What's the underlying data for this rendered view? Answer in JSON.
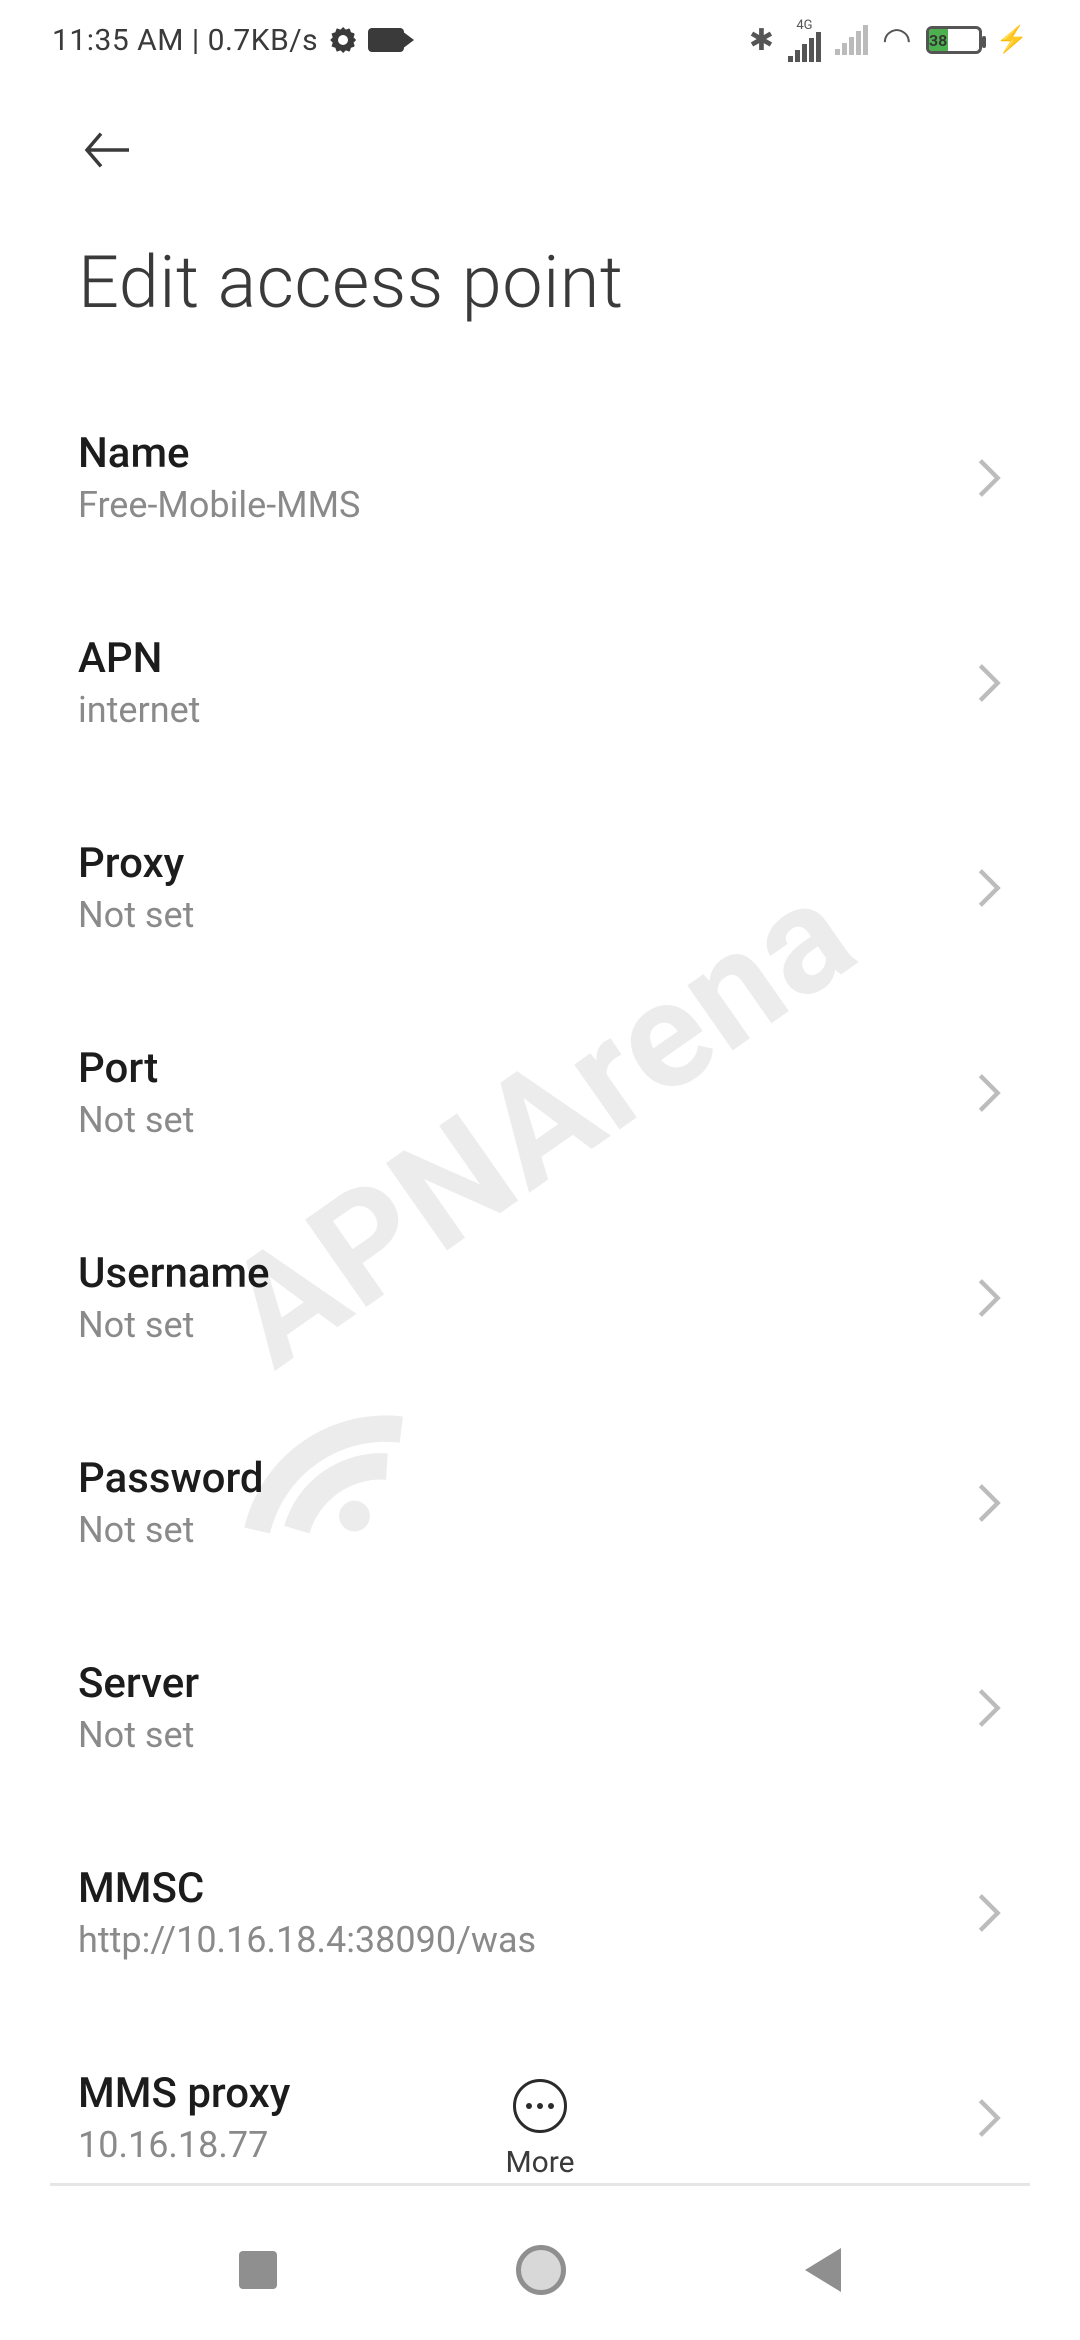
{
  "status": {
    "time": "11:35 AM",
    "net_speed": "0.7KB/s",
    "signal_label": "4G",
    "battery_pct": "38"
  },
  "page": {
    "title": "Edit access point"
  },
  "settings": [
    {
      "key": "name",
      "label": "Name",
      "value": "Free-Mobile-MMS"
    },
    {
      "key": "apn",
      "label": "APN",
      "value": "internet"
    },
    {
      "key": "proxy",
      "label": "Proxy",
      "value": "Not set"
    },
    {
      "key": "port",
      "label": "Port",
      "value": "Not set"
    },
    {
      "key": "username",
      "label": "Username",
      "value": "Not set"
    },
    {
      "key": "password",
      "label": "Password",
      "value": "Not set"
    },
    {
      "key": "server",
      "label": "Server",
      "value": "Not set"
    },
    {
      "key": "mmsc",
      "label": "MMSC",
      "value": "http://10.16.18.4:38090/was"
    },
    {
      "key": "mms-proxy",
      "label": "MMS proxy",
      "value": "10.16.18.77"
    }
  ],
  "toolbar": {
    "more_label": "More"
  },
  "watermark": "APNArena"
}
